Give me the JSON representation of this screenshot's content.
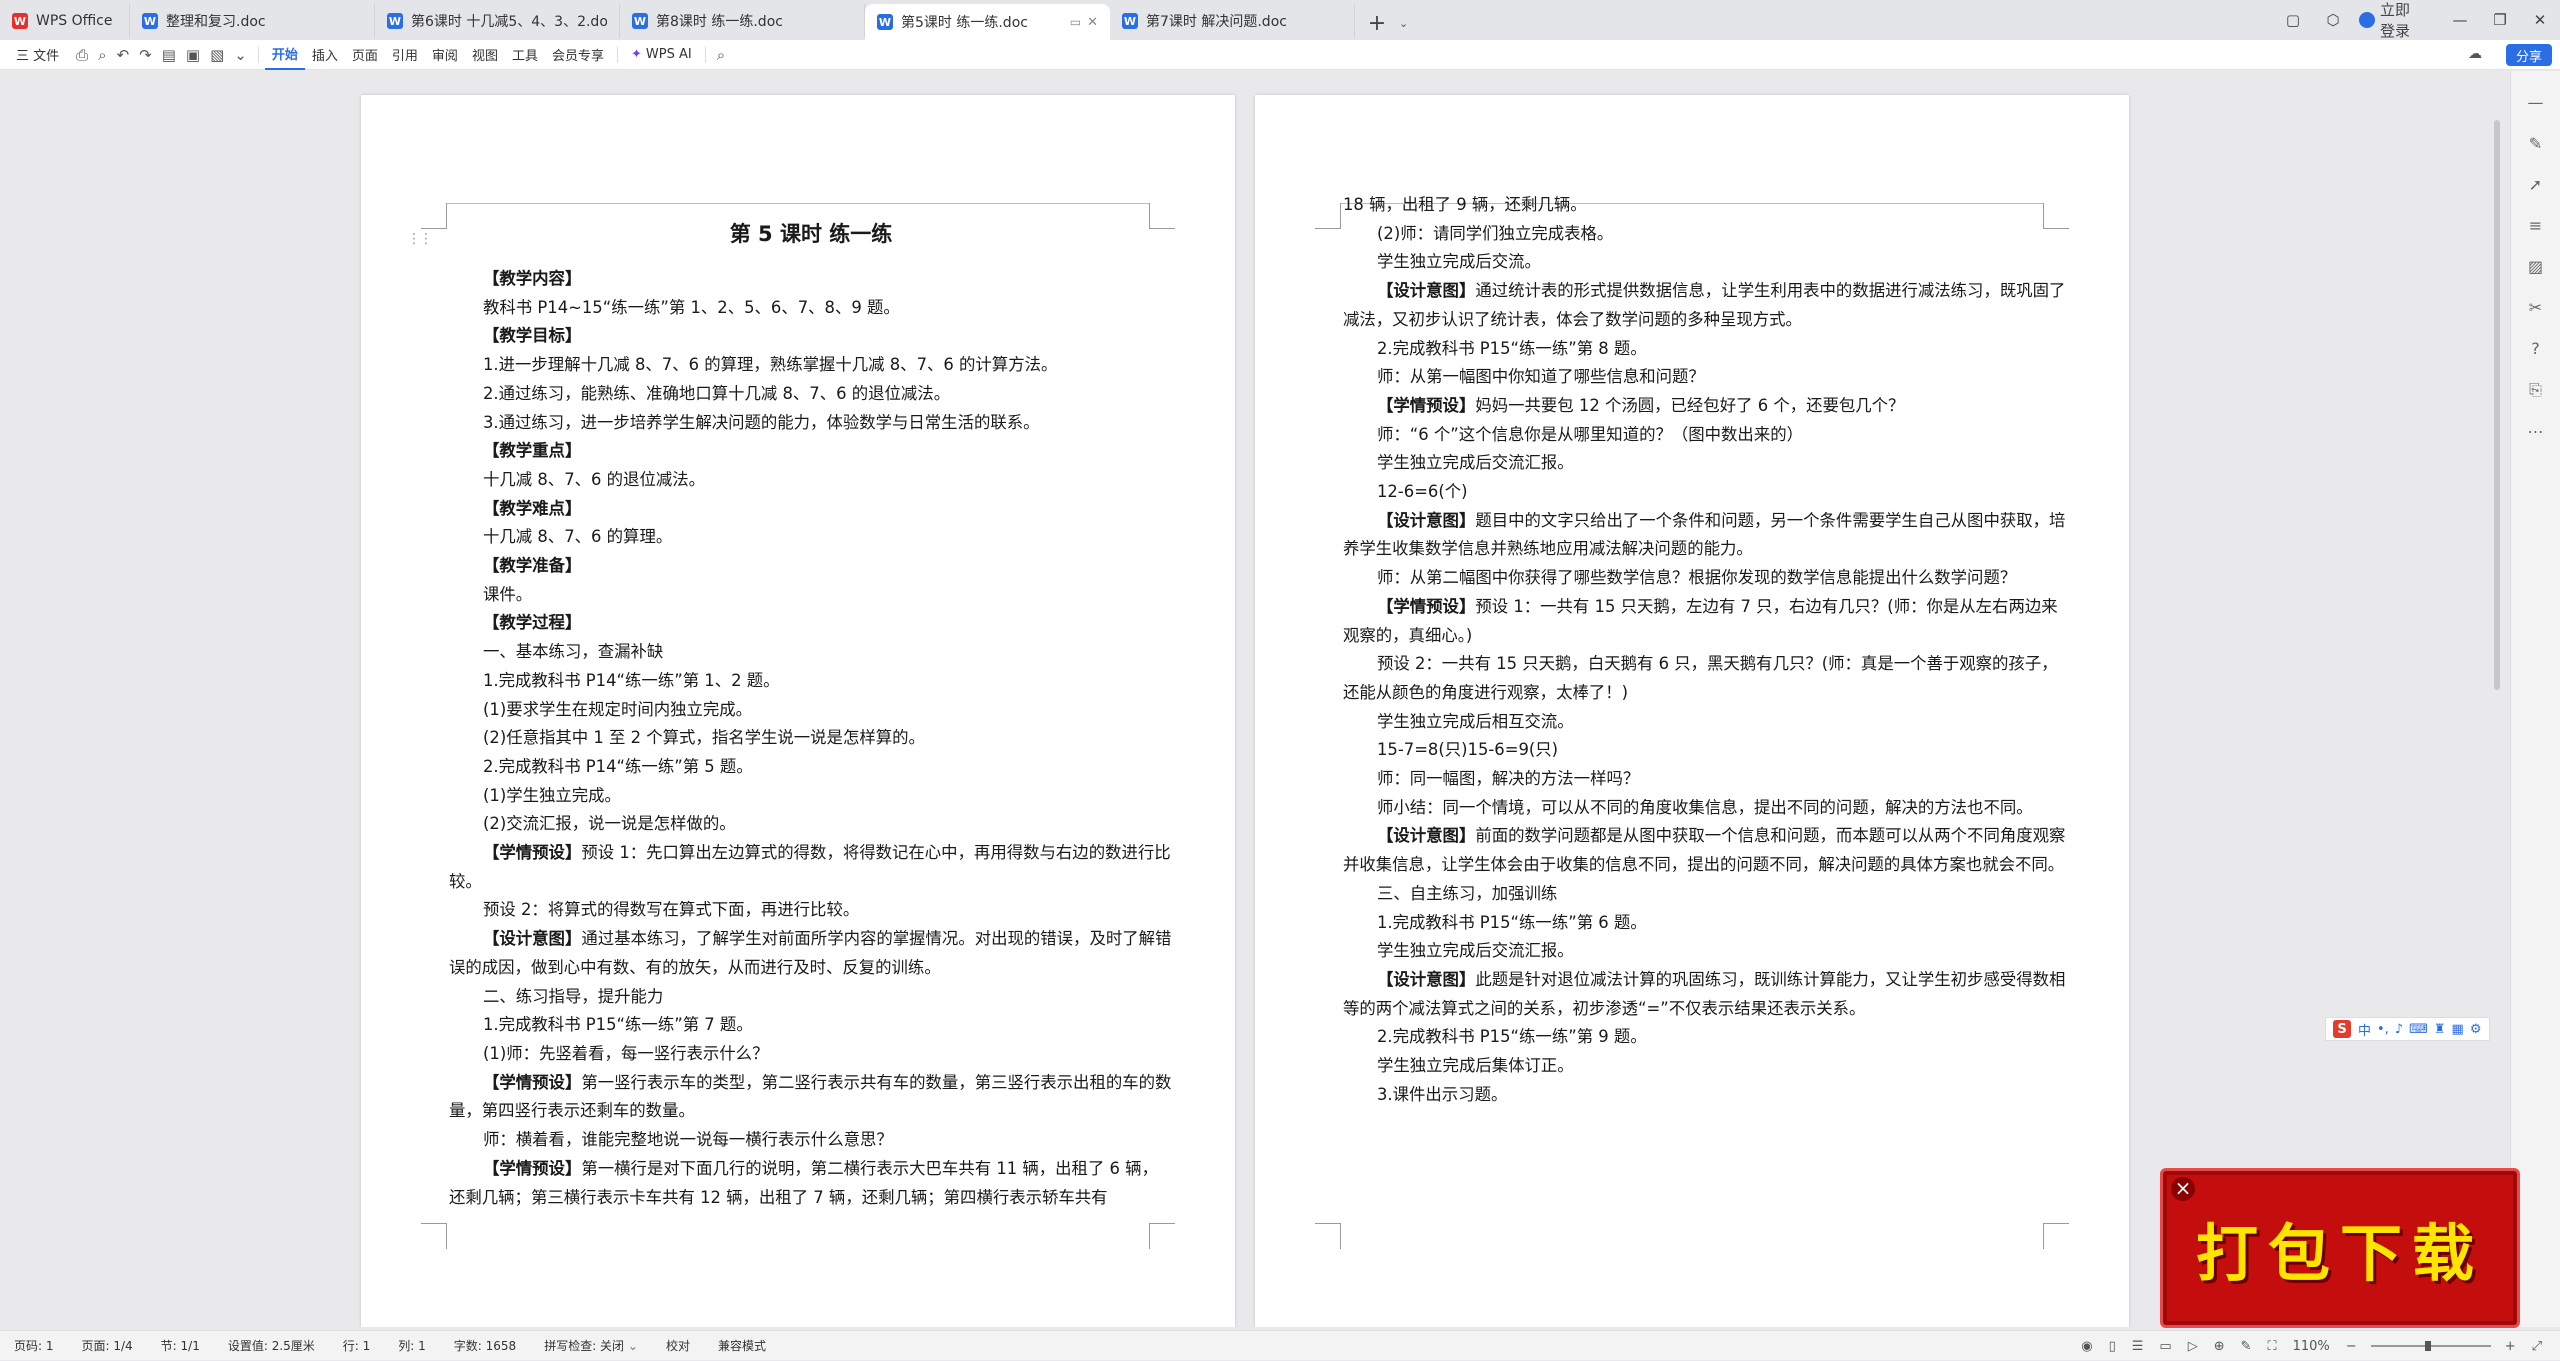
{
  "tabs": [
    {
      "label": "WPS Office",
      "type": "home",
      "active": false
    },
    {
      "label": "整理和复习.doc",
      "type": "doc",
      "active": false
    },
    {
      "label": "第6课时 十几减5、4、3、2.doc",
      "type": "doc",
      "active": false
    },
    {
      "label": "第8课时 练一练.doc",
      "type": "doc",
      "active": false
    },
    {
      "label": "第5课时 练一练.doc",
      "type": "doc",
      "active": true
    },
    {
      "label": "第7课时 解决问题.doc",
      "type": "doc",
      "active": false
    }
  ],
  "title_bar": {
    "login_label": "立即登录"
  },
  "toolbar": {
    "file_label": "三 文件",
    "ribbon_tabs": [
      "开始",
      "插入",
      "页面",
      "引用",
      "审阅",
      "视图",
      "工具",
      "会员专享"
    ],
    "active_tab": "开始",
    "ai_label": "WPS AI",
    "share_label": "分享"
  },
  "page1": {
    "title": "第 5 课时  练一练",
    "lines": [
      {
        "b": "【教学内容】",
        "t": ""
      },
      {
        "b": "",
        "t": "教科书 P14~15“练一练”第 1、2、5、6、7、8、9 题。"
      },
      {
        "b": "【教学目标】",
        "t": ""
      },
      {
        "b": "",
        "t": "1.进一步理解十几减 8、7、6 的算理，熟练掌握十几减 8、7、6 的计算方法。"
      },
      {
        "b": "",
        "t": "2.通过练习，能熟练、准确地口算十几减 8、7、6 的退位减法。"
      },
      {
        "b": "",
        "t": "3.通过练习，进一步培养学生解决问题的能力，体验数学与日常生活的联系。"
      },
      {
        "b": "【教学重点】",
        "t": ""
      },
      {
        "b": "",
        "t": "十几减 8、7、6 的退位减法。"
      },
      {
        "b": "【教学难点】",
        "t": ""
      },
      {
        "b": "",
        "t": "十几减 8、7、6 的算理。"
      },
      {
        "b": "【教学准备】",
        "t": ""
      },
      {
        "b": "",
        "t": "课件。"
      },
      {
        "b": "【教学过程】",
        "t": ""
      },
      {
        "b": "",
        "t": "一、基本练习，查漏补缺"
      },
      {
        "b": "",
        "t": "1.完成教科书 P14“练一练”第 1、2 题。"
      },
      {
        "b": "",
        "t": "(1)要求学生在规定时间内独立完成。"
      },
      {
        "b": "",
        "t": "(2)任意指其中 1 至 2 个算式，指名学生说一说是怎样算的。"
      },
      {
        "b": "",
        "t": "2.完成教科书 P14“练一练”第 5 题。"
      },
      {
        "b": "",
        "t": "(1)学生独立完成。"
      },
      {
        "b": "",
        "t": "(2)交流汇报，说一说是怎样做的。"
      },
      {
        "b": "【学情预设】",
        "t": "预设 1：先口算出左边算式的得数，将得数记在心中，再用得数与右边的数进行比较。"
      },
      {
        "b": "",
        "t": "预设 2：将算式的得数写在算式下面，再进行比较。"
      },
      {
        "b": "【设计意图】",
        "t": "通过基本练习，了解学生对前面所学内容的掌握情况。对出现的错误，及时了解错误的成因，做到心中有数、有的放矢，从而进行及时、反复的训练。"
      },
      {
        "b": "",
        "t": "二、练习指导，提升能力"
      },
      {
        "b": "",
        "t": "1.完成教科书 P15“练一练”第 7 题。"
      },
      {
        "b": "",
        "t": "(1)师：先竖着看，每一竖行表示什么？"
      },
      {
        "b": "【学情预设】",
        "t": "第一竖行表示车的类型，第二竖行表示共有车的数量，第三竖行表示出租的车的数量，第四竖行表示还剩车的数量。"
      },
      {
        "b": "",
        "t": "师：横着看，谁能完整地说一说每一横行表示什么意思？"
      },
      {
        "b": "【学情预设】",
        "t": "第一横行是对下面几行的说明，第二横行表示大巴车共有 11 辆，出租了 6 辆，还剩几辆；第三横行表示卡车共有 12 辆，出租了 7 辆，还剩几辆；第四横行表示轿车共有"
      }
    ]
  },
  "page2": {
    "lines": [
      {
        "b": "",
        "t": "18 辆，出租了 9 辆，还剩几辆。",
        "ni": true
      },
      {
        "b": "",
        "t": "(2)师：请同学们独立完成表格。"
      },
      {
        "b": "",
        "t": "学生独立完成后交流。"
      },
      {
        "b": "【设计意图】",
        "t": "通过统计表的形式提供数据信息，让学生利用表中的数据进行减法练习，既巩固了减法，又初步认识了统计表，体会了数学问题的多种呈现方式。"
      },
      {
        "b": "",
        "t": "2.完成教科书 P15“练一练”第 8 题。"
      },
      {
        "b": "",
        "t": "师：从第一幅图中你知道了哪些信息和问题？"
      },
      {
        "b": "【学情预设】",
        "t": "妈妈一共要包 12 个汤圆，已经包好了 6 个，还要包几个？"
      },
      {
        "b": "",
        "t": "师：“6 个”这个信息你是从哪里知道的？（图中数出来的）"
      },
      {
        "b": "",
        "t": "学生独立完成后交流汇报。"
      },
      {
        "b": "",
        "t": "12-6=6(个)"
      },
      {
        "b": "【设计意图】",
        "t": "题目中的文字只给出了一个条件和问题，另一个条件需要学生自己从图中获取，培养学生收集数学信息并熟练地应用减法解决问题的能力。"
      },
      {
        "b": "",
        "t": "师：从第二幅图中你获得了哪些数学信息？根据你发现的数学信息能提出什么数学问题？"
      },
      {
        "b": "【学情预设】",
        "t": "预设 1：一共有 15 只天鹅，左边有 7 只，右边有几只？(师：你是从左右两边来观察的，真细心。)"
      },
      {
        "b": "",
        "t": "预设 2：一共有 15 只天鹅，白天鹅有 6 只，黑天鹅有几只？(师：真是一个善于观察的孩子，还能从颜色的角度进行观察，太棒了！)"
      },
      {
        "b": "",
        "t": "学生独立完成后相互交流。"
      },
      {
        "b": "",
        "t": "15-7=8(只)15-6=9(只)"
      },
      {
        "b": "",
        "t": "师：同一幅图，解决的方法一样吗？"
      },
      {
        "b": "",
        "t": "师小结：同一个情境，可以从不同的角度收集信息，提出不同的问题，解决的方法也不同。"
      },
      {
        "b": "【设计意图】",
        "t": "前面的数学问题都是从图中获取一个信息和问题，而本题可以从两个不同角度观察并收集信息，让学生体会由于收集的信息不同，提出的问题不同，解决问题的具体方案也就会不同。"
      },
      {
        "b": "",
        "t": "三、自主练习，加强训练"
      },
      {
        "b": "",
        "t": "1.完成教科书 P15“练一练”第 6 题。"
      },
      {
        "b": "",
        "t": "学生独立完成后交流汇报。"
      },
      {
        "b": "【设计意图】",
        "t": "此题是针对退位减法计算的巩固练习，既训练计算能力，又让学生初步感受得数相等的两个减法算式之间的关系，初步渗透“=”不仅表示结果还表示关系。"
      },
      {
        "b": "",
        "t": "2.完成教科书 P15“练一练”第 9 题。"
      },
      {
        "b": "",
        "t": "学生独立完成后集体订正。"
      },
      {
        "b": "",
        "t": "3.课件出示习题。"
      }
    ]
  },
  "status": {
    "page_num": "页码: 1",
    "page_of": "页面: 1/4",
    "section": "节: 1/1",
    "settings": "设置值: 2.5厘米",
    "row": "行: 1",
    "col": "列: 1",
    "word_count": "字数: 1658",
    "spell": "拼写检查: 关闭",
    "proof": "校对",
    "compat": "兼容模式",
    "zoom": "110%"
  },
  "ime": {
    "mode": "中"
  },
  "promo": {
    "text": "打包下载"
  },
  "colors": {
    "accent": "#2b6de5",
    "promo_bg": "#c40d0d",
    "promo_text": "#ffe400"
  }
}
